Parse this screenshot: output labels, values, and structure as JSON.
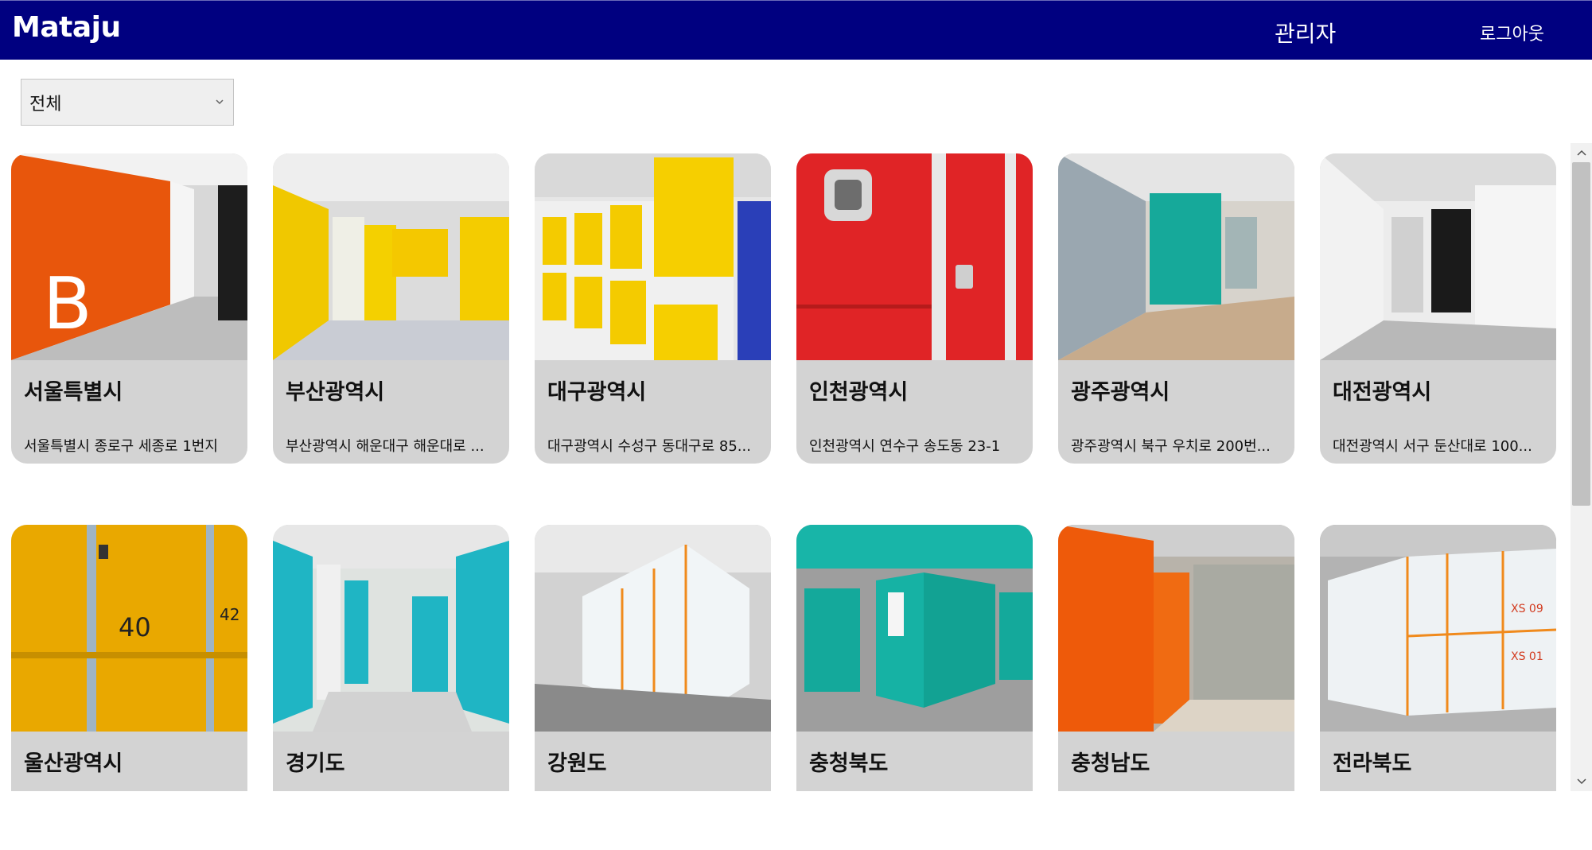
{
  "header": {
    "brand": "Mataju",
    "admin_label": "관리자",
    "logout_label": "로그아웃",
    "bg_color": "#000080"
  },
  "filter": {
    "selected": "전체",
    "icon": "chevron-down-icon"
  },
  "cards": [
    {
      "name": "서울특별시",
      "address": "서울특별시 종로구 세종로 1번지",
      "theme": "orange-wall"
    },
    {
      "name": "부산광역시",
      "address": "부산광역시 해운대구 해운대로 ...",
      "theme": "yellow-corridor"
    },
    {
      "name": "대구광역시",
      "address": "대구광역시 수성구 동대구로 85...",
      "theme": "yellow-lockers"
    },
    {
      "name": "인천광역시",
      "address": "인천광역시 연수구 송도동 23-1",
      "theme": "red-lockers"
    },
    {
      "name": "광주광역시",
      "address": "광주광역시 북구 우치로 200번...",
      "theme": "teal-room"
    },
    {
      "name": "대전광역시",
      "address": "대전광역시 서구 둔산대로 100...",
      "theme": "white-corridor"
    },
    {
      "name": "울산광역시",
      "address": "",
      "theme": "amber-lockers"
    },
    {
      "name": "경기도",
      "address": "",
      "theme": "cyan-corridor"
    },
    {
      "name": "강원도",
      "address": "",
      "theme": "white-orange-units"
    },
    {
      "name": "충청북도",
      "address": "",
      "theme": "teal-units"
    },
    {
      "name": "충청남도",
      "address": "",
      "theme": "orange-doors"
    },
    {
      "name": "전라북도",
      "address": "",
      "theme": "xs-units"
    }
  ]
}
